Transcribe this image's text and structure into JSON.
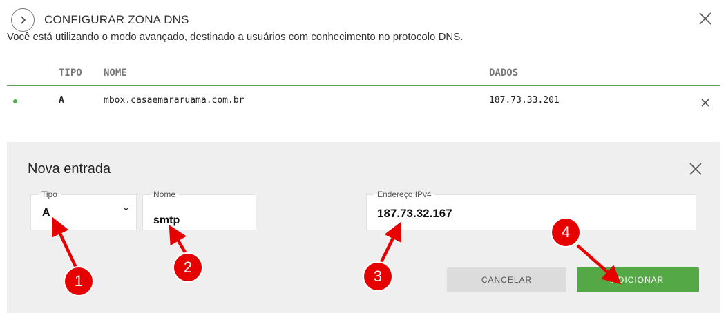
{
  "header": {
    "title": "CONFIGURAR ZONA DNS"
  },
  "subtitle": "Você está utilizando o modo avançado, destinado a usuários com conhecimento no protocolo DNS.",
  "table": {
    "columns": [
      "TIPO",
      "NOME",
      "DADOS"
    ],
    "rows": [
      {
        "status_color": "#4caf50",
        "tipo": "A",
        "nome": "mbox.casaemararuama.com.br",
        "dados": "187.73.33.201"
      }
    ]
  },
  "panel": {
    "title": "Nova entrada",
    "tipo": {
      "label": "Tipo",
      "value": "A"
    },
    "nome": {
      "label": "Nome",
      "value": "smtp"
    },
    "endereco": {
      "label": "Endereço IPv4",
      "value": "187.73.32.167"
    },
    "cancel_label": "CANCELAR",
    "add_label": "ADICIONAR"
  },
  "annotations": [
    "1",
    "2",
    "3",
    "4"
  ],
  "colors": {
    "accent_green": "#55a846",
    "divider_green": "#5aa05a",
    "panel_bg": "#efefef",
    "annotation_red": "#e60000"
  }
}
